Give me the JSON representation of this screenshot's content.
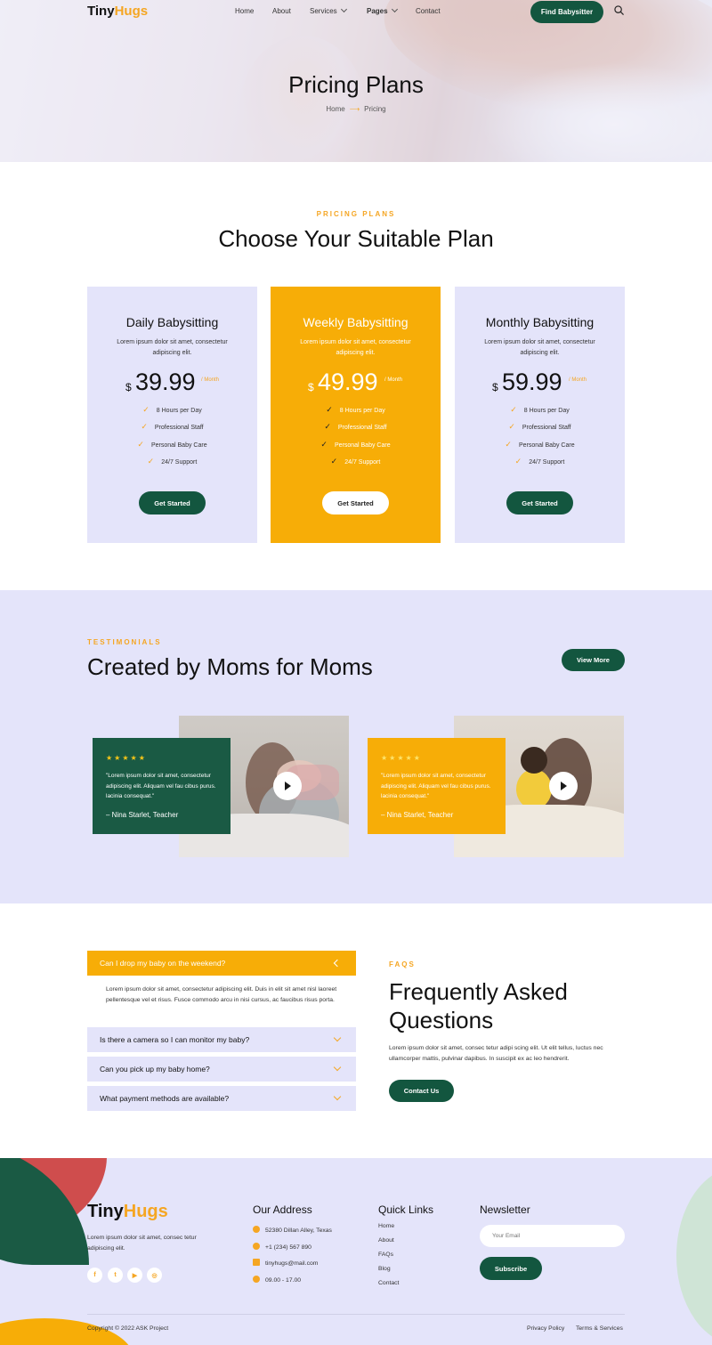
{
  "brand": {
    "part1": "Tiny",
    "part2": "Hugs"
  },
  "nav": {
    "items": [
      "Home",
      "About",
      "Services",
      "Pages",
      "Contact"
    ],
    "cta": "Find Babysitter"
  },
  "hero": {
    "title": "Pricing Plans",
    "breadcrumb": {
      "home": "Home",
      "current": "Pricing"
    }
  },
  "pricing": {
    "eyebrow": "PRICING PLANS",
    "title": "Choose Your Suitable Plan",
    "plans": [
      {
        "name": "Daily Babysitting",
        "desc": "Lorem ipsum dolor sit amet, consectetur adipiscing elit.",
        "currency": "$",
        "price": "39.99",
        "period": "/ Month",
        "features": [
          "8 Hours per Day",
          "Professional Staff",
          "Personal Baby Care",
          "24/7 Support"
        ],
        "cta": "Get Started"
      },
      {
        "name": "Weekly Babysitting",
        "desc": "Lorem ipsum dolor sit amet, consectetur adipiscing elit.",
        "currency": "$",
        "price": "49.99",
        "period": "/ Month",
        "features": [
          "8 Hours per Day",
          "Professional Staff",
          "Personal Baby Care",
          "24/7 Support"
        ],
        "cta": "Get Started"
      },
      {
        "name": "Monthly Babysitting",
        "desc": "Lorem ipsum dolor sit amet, consectetur adipiscing elit.",
        "currency": "$",
        "price": "59.99",
        "period": "/ Month",
        "features": [
          "8 Hours per Day",
          "Professional Staff",
          "Personal Baby Care",
          "24/7 Support"
        ],
        "cta": "Get Started"
      }
    ]
  },
  "testimonials": {
    "eyebrow": "TESTIMONIALS",
    "title": "Created by Moms for Moms",
    "cta": "View More",
    "items": [
      {
        "stars": "★★★★★",
        "quote": "\"Lorem ipsum dolor sit amet, consectetur adipiscing elit. Aliquam vel fau cibus purus. lacinia consequat.\"",
        "author": "– Nina Starlet, Teacher"
      },
      {
        "stars": "★★★★★",
        "quote": "\"Lorem ipsum dolor sit amet, consectetur adipiscing elit. Aliquam vel fau cibus purus. lacinia consequat.\"",
        "author": "– Nina Starlet, Teacher"
      }
    ]
  },
  "faq": {
    "eyebrow": "FAQS",
    "title_line1": "Frequently Asked",
    "title_line2": "Questions",
    "description": "Lorem ipsum dolor sit amet, consec tetur adipi scing elit. Ut elit tellus, luctus nec ullamcorper mattis, pulvinar dapibus. In suscipit ex ac leo hendrerit.",
    "cta": "Contact Us",
    "items": [
      {
        "q": "Can I drop my baby on the weekend?",
        "a": "Lorem ipsum dolor sit amet, consectetur adipiscing elit. Duis in elit sit amet nisl laoreet pellentesque vel et risus. Fusce commodo arcu in nisi cursus, ac faucibus risus porta."
      },
      {
        "q": "Is there a camera so I can monitor my baby?"
      },
      {
        "q": "Can you pick up my baby home?"
      },
      {
        "q": "What payment methods are available?"
      }
    ]
  },
  "footer": {
    "description": "Lorem ipsum dolor sit amet, consec tetur adipiscing elit.",
    "social": [
      "facebook-icon",
      "twitter-icon",
      "youtube-icon",
      "instagram-icon"
    ],
    "address_title": "Our Address",
    "address": [
      "52380 Dillan Alley, Texas",
      "+1 (234) 567 890",
      "tinyhugs@mail.com",
      "09.00 - 17.00"
    ],
    "links_title": "Quick Links",
    "links": [
      "Home",
      "About",
      "FAQs",
      "Blog",
      "Contact"
    ],
    "newsletter_title": "Newsletter",
    "email_placeholder": "Your Email",
    "subscribe": "Subscribe",
    "copyright": "Copyright © 2022 ASK Project",
    "legal": [
      "Privacy Policy",
      "Terms & Services"
    ]
  },
  "colors": {
    "accent": "#f7ad07",
    "primary": "#13563f",
    "lavender": "#e4e4fa"
  }
}
